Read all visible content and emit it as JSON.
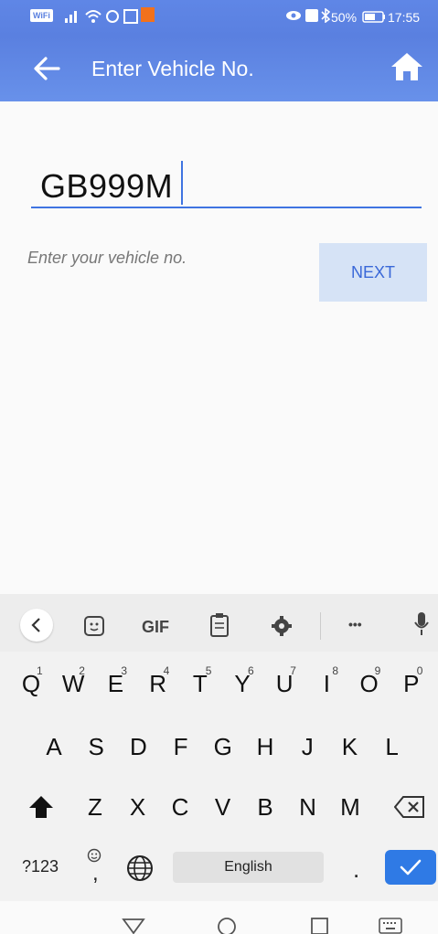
{
  "status": {
    "wifi_label": "WiFi",
    "battery": "50%",
    "time": "17:55"
  },
  "app": {
    "title": "Enter Vehicle No."
  },
  "form": {
    "vehicle_value": "GB999M",
    "hint": "Enter your vehicle no.",
    "next_label": "NEXT"
  },
  "keyboard": {
    "toolbar": {
      "gif": "GIF",
      "more": "•••"
    },
    "row1": [
      "Q",
      "W",
      "E",
      "R",
      "T",
      "Y",
      "U",
      "I",
      "O",
      "P"
    ],
    "row1_numbers": [
      "1",
      "2",
      "3",
      "4",
      "5",
      "6",
      "7",
      "8",
      "9",
      "0"
    ],
    "row2": [
      "A",
      "S",
      "D",
      "F",
      "G",
      "H",
      "J",
      "K",
      "L"
    ],
    "row3": [
      "Z",
      "X",
      "C",
      "V",
      "B",
      "N",
      "M"
    ],
    "symbols_label": "?123",
    "comma_label": ",",
    "space_label": "English",
    "period_label": "."
  },
  "colors": {
    "accent": "#5a80e0",
    "button_bg": "#d6e3f6",
    "button_text": "#3a68d8",
    "enter_key": "#2f7ae5"
  },
  "icons": [
    "back-arrow-icon",
    "home-icon",
    "wifi-icon",
    "signal-icon",
    "bluetooth-icon",
    "battery-icon",
    "chevron-left-icon",
    "sticker-icon",
    "clipboard-icon",
    "gear-icon",
    "mic-icon",
    "shift-icon",
    "backspace-icon",
    "emoji-icon",
    "globe-icon",
    "check-icon",
    "nav-back-icon",
    "nav-home-icon",
    "nav-recent-icon",
    "nav-keyboard-icon"
  ]
}
